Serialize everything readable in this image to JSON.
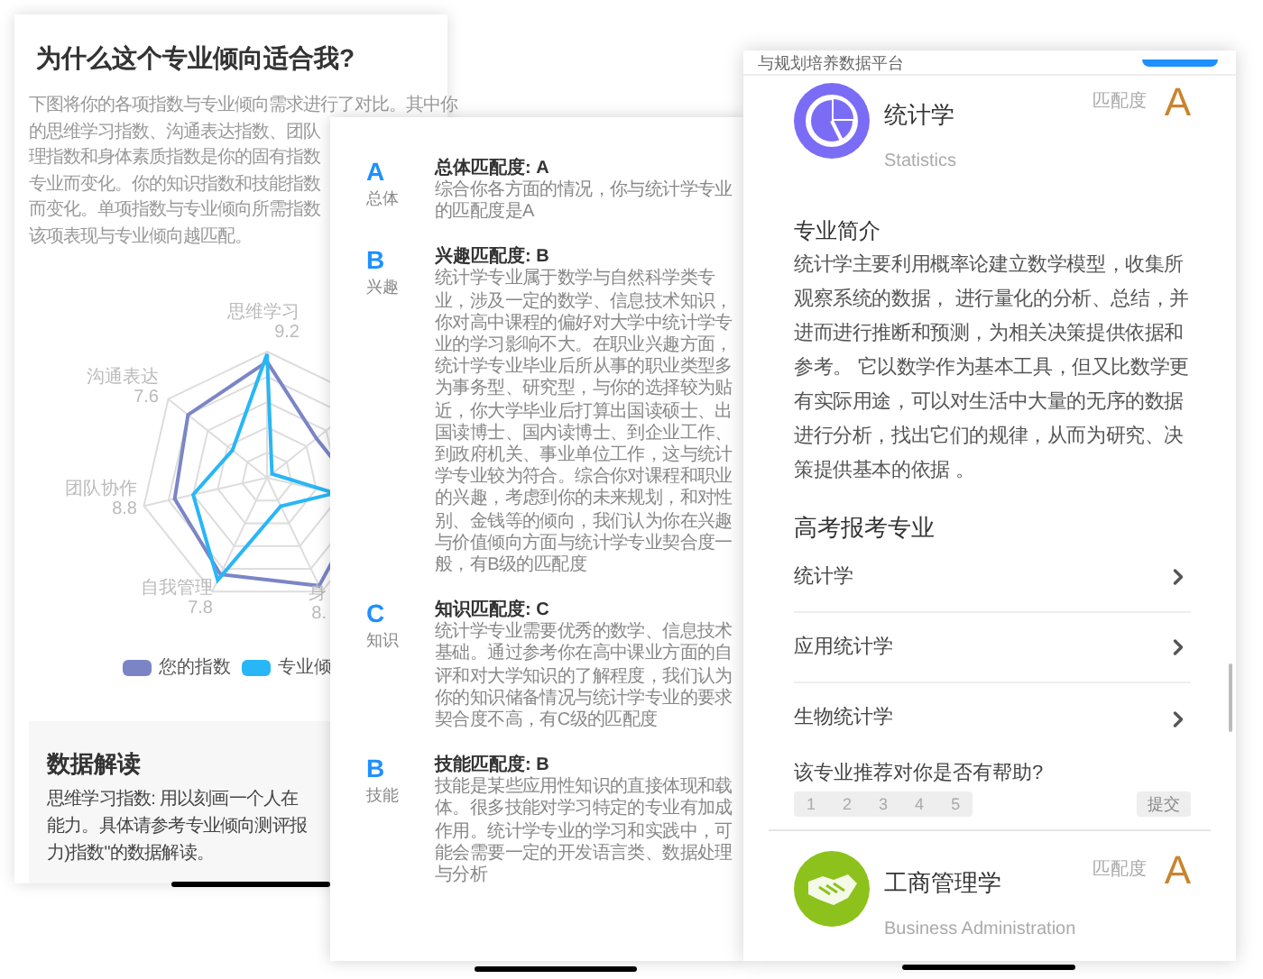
{
  "report_card": {
    "title": "为什么这个专业倾向适合我?",
    "intro_lines": [
      "下图将你的各项指数与专业倾向需求进行了对比。其中你",
      "的思维学习指数、沟通表达指数、团队",
      "理指数和身体素质指数是你的固有指数",
      "专业而变化。你的知识指数和技能指数",
      "而变化。单项指数与专业倾向所需指数",
      "该项表现与专业倾向越匹配。"
    ],
    "radar_labels": [
      {
        "name": "思维学习",
        "value": "9.2"
      },
      {
        "name": "沟通表达",
        "value": "7.6"
      },
      {
        "name": "团队协作",
        "value": "8.8"
      },
      {
        "name": "自我管理",
        "value": "7.8"
      },
      {
        "name": "身",
        "value": "8."
      }
    ],
    "legend": [
      {
        "label": "您的指数",
        "color": "#7b85c6"
      },
      {
        "label": "专业倾",
        "color": "#29b6f6"
      }
    ],
    "data_section": {
      "title": "数据解读",
      "lines": [
        "思维学习指数: 用以刻画一个人在",
        "能力。具体请参考专业倾向测评报",
        "力)指数\"的数据解读。"
      ]
    }
  },
  "match_card": {
    "items": [
      {
        "grade": "A",
        "label": "总体",
        "title": "总体匹配度: A",
        "body": "综合你各方面的情况，你与统计学专业的匹配度是A"
      },
      {
        "grade": "B",
        "label": "兴趣",
        "title": "兴趣匹配度: B",
        "body": "统计学专业属于数学与自然科学类专业，涉及一定的数学、信息技术知识，你对高中课程的偏好对大学中统计学专业的学习影响不大。在职业兴趣方面，统计学专业毕业后所从事的职业类型多为事务型、研究型，与你的选择较为贴近，你大学毕业后打算出国读硕士、出国读博士、国内读博士、到企业工作、到政府机关、事业单位工作，这与统计学专业较为符合。综合你对课程和职业的兴趣，考虑到你的未来规划，和对性别、金钱等的倾向，我们认为你在兴趣与价值倾向方面与统计学专业契合度一般，有B级的匹配度"
      },
      {
        "grade": "C",
        "label": "知识",
        "title": "知识匹配度: C",
        "body": "统计学专业需要优秀的数学、信息技术基础。通过参考你在高中课业方面的自评和对大学知识的了解程度，我们认为你的知识储备情况与统计学专业的要求契合度不高，有C级的匹配度"
      },
      {
        "grade": "B",
        "label": "技能",
        "title": "技能匹配度: B",
        "body": "技能是某些应用性知识的直接体现和载体。很多技能对学习特定的专业有加成作用。统计学专业的学习和实践中，可能会需要一定的开发语言类、数据处理与分析"
      }
    ]
  },
  "major_card": {
    "header": "与规划培养数据平台",
    "majors": [
      {
        "kind": "chart",
        "name": "统计学",
        "english": "Statistics",
        "match_label": "匹配度",
        "grade": "A",
        "color": "#7b6cf6"
      },
      {
        "kind": "handshake",
        "name": "工商管理学",
        "english": "Business Administration",
        "match_label": "匹配度",
        "grade": "A",
        "color": "#8cc21b"
      }
    ],
    "intro_title": "专业简介",
    "intro": "统计学主要利用概率论建立数学模型，收集所观察系统的数据， 进行量化的分析、总结，并进而进行推断和预测，为相关决策提供依据和参考。 它以数学作为基本工具，但又比数学更有实际用途，可以对生活中大量的无序的数据进行分析，找出它们的规律，从而为研究、决策提供基本的依据 。",
    "exam_title": "高考报考专业",
    "exam_majors": [
      "统计学",
      "应用统计学",
      "生物统计学"
    ],
    "feedback": {
      "question": "该专业推荐对你是否有帮助?",
      "options": [
        {
          "label": "1",
          "selected": false
        },
        {
          "label": "2",
          "selected": false
        },
        {
          "label": "3",
          "selected": false
        },
        {
          "label": "4",
          "selected": false
        },
        {
          "label": "5",
          "selected": false
        }
      ],
      "submit": {
        "label": "提交",
        "disabled": true
      }
    }
  }
}
